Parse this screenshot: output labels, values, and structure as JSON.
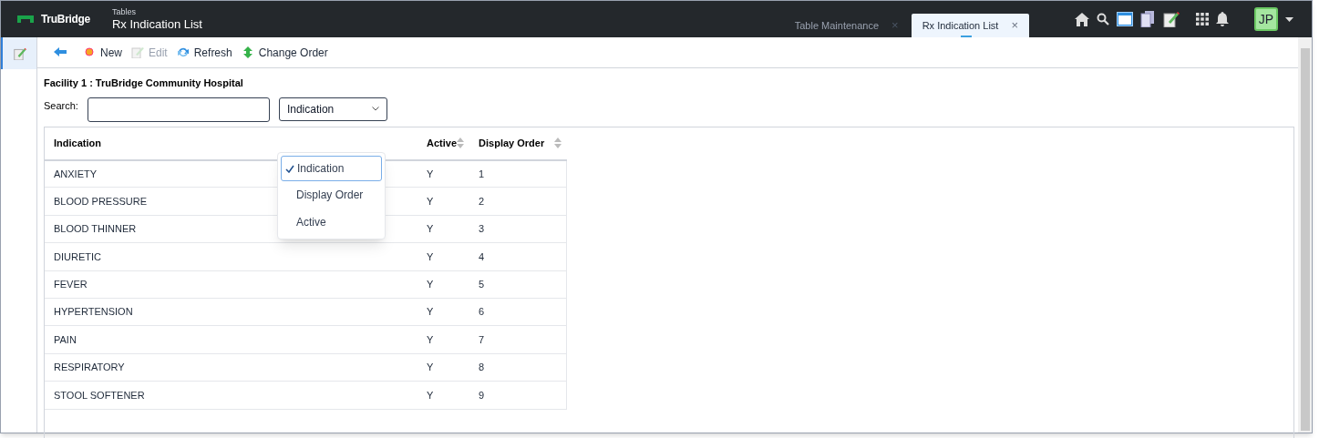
{
  "header": {
    "brand": "TruBridge",
    "subtitle": "Tables",
    "title": "Rx Indication List"
  },
  "tabs": [
    {
      "label": "Table Maintenance",
      "close": "×",
      "selected": false
    },
    {
      "label": "Rx Indication List",
      "close": "×",
      "selected": true
    }
  ],
  "user": {
    "initials": "JP"
  },
  "toolbar": [
    {
      "kind": "back"
    },
    {
      "kind": "new",
      "label": "New",
      "disabled": false
    },
    {
      "kind": "edit",
      "label": "Edit",
      "disabled": true
    },
    {
      "kind": "refresh",
      "label": "Refresh",
      "disabled": false
    },
    {
      "kind": "order",
      "label": "Change Order",
      "disabled": false
    }
  ],
  "facility": "Facility 1 : TruBridge Community Hospital",
  "search": {
    "label": "Search:"
  },
  "sort_select": {
    "value": "Indication",
    "options": [
      {
        "label": "Indication",
        "selected": true
      },
      {
        "label": "Display Order",
        "selected": false
      },
      {
        "label": "Active",
        "selected": false
      }
    ]
  },
  "table": {
    "columns": [
      {
        "label": "Indication",
        "sortable": false
      },
      {
        "label": "Active",
        "sortable": true
      },
      {
        "label": "Display Order",
        "sortable": true
      }
    ],
    "rows": [
      [
        "ANXIETY",
        "Y",
        "1"
      ],
      [
        "BLOOD PRESSURE",
        "Y",
        "2"
      ],
      [
        "BLOOD THINNER",
        "Y",
        "3"
      ],
      [
        "DIURETIC",
        "Y",
        "4"
      ],
      [
        "FEVER",
        "Y",
        "5"
      ],
      [
        "HYPERTENSION",
        "Y",
        "6"
      ],
      [
        "PAIN",
        "Y",
        "7"
      ],
      [
        "RESPIRATORY",
        "Y",
        "8"
      ],
      [
        "STOOL SOFTENER",
        "Y",
        "9"
      ]
    ]
  }
}
